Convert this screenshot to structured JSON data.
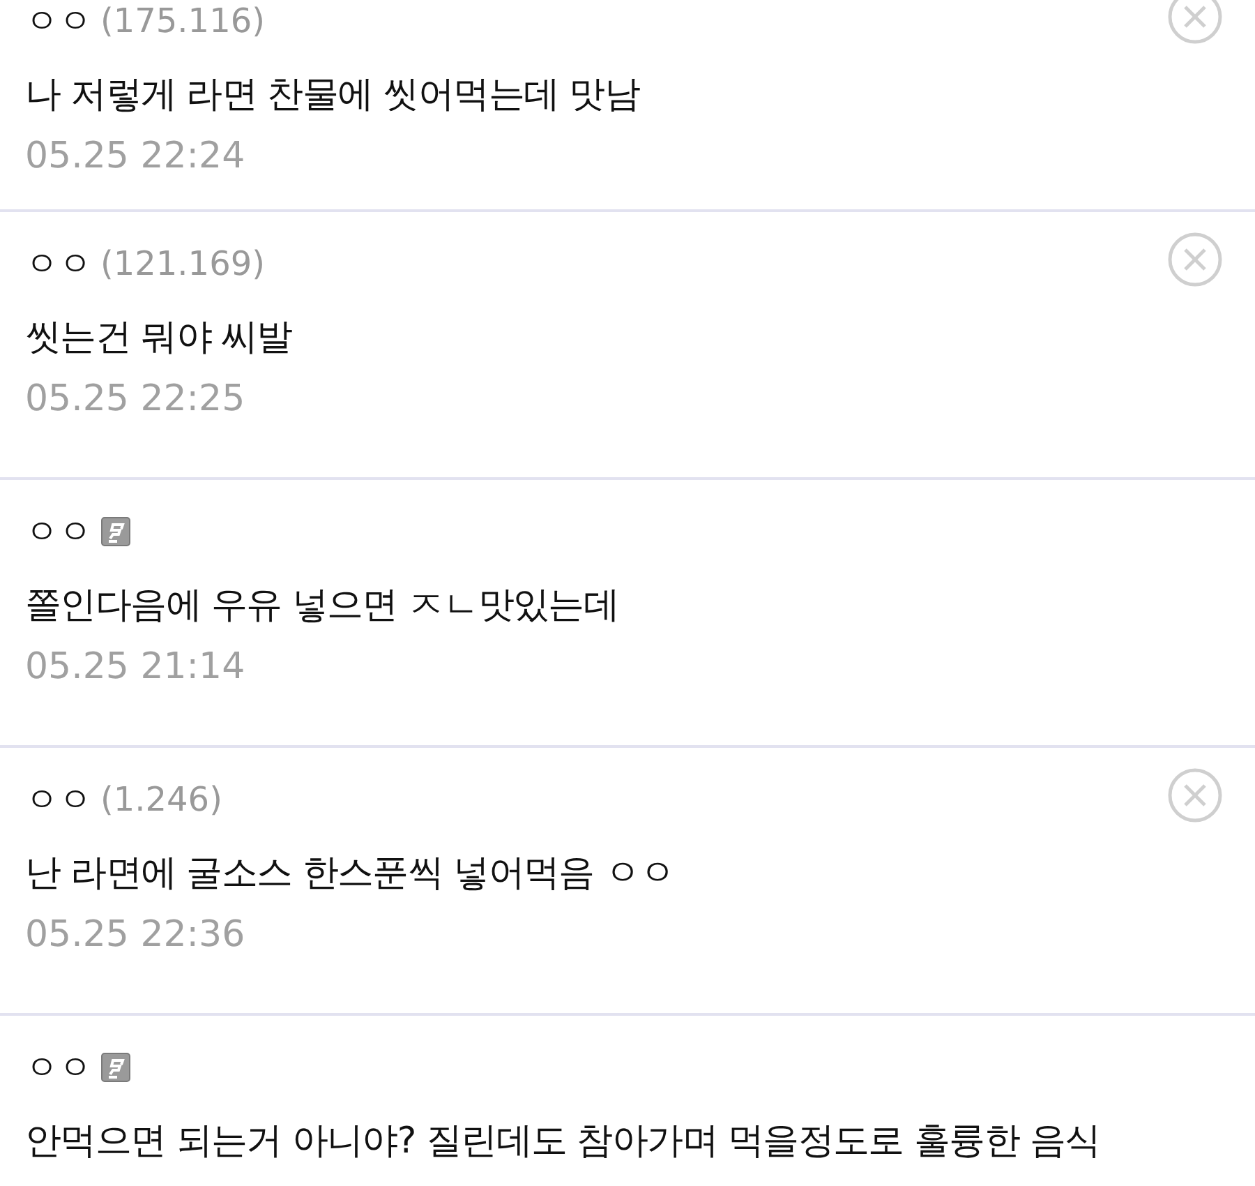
{
  "comments": [
    {
      "kind": "guest",
      "nickname": "ㅇㅇ",
      "ip": "(175.116)",
      "deletable": true,
      "body": "나 저렇게 라면 찬물에 씻어먹는데 맛남",
      "date": "05.25 22:24"
    },
    {
      "kind": "guest",
      "nickname": "ㅇㅇ",
      "ip": "(121.169)",
      "deletable": true,
      "body": "씻는건 뭐야 씨발",
      "date": "05.25 22:25"
    },
    {
      "kind": "member",
      "nickname": "ㅇㅇ",
      "deletable": false,
      "body": "쫄인다음에 우유 넣으면 ㅈㄴ맛있는데",
      "date": "05.25 21:14"
    },
    {
      "kind": "guest",
      "nickname": "ㅇㅇ",
      "ip": "(1.246)",
      "deletable": true,
      "body": "난 라면에 굴소스 한스푼씩 넣어먹음 ㅇㅇ",
      "date": "05.25 22:36"
    },
    {
      "kind": "member",
      "nickname": "ㅇㅇ",
      "deletable": false,
      "body": "안먹으면 되는거 아니야? 질린데도 참아가며 먹을정도로 훌륭한 음식"
    }
  ]
}
